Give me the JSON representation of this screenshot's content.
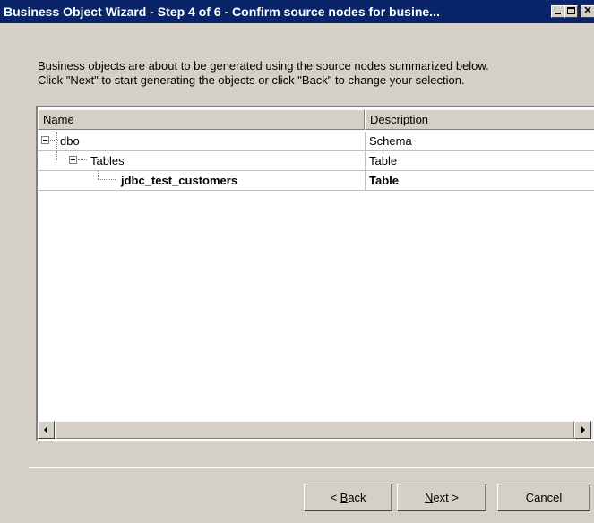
{
  "window": {
    "title": "Business Object Wizard - Step 4 of 6 - Confirm source nodes for busine..."
  },
  "instructions": {
    "line1": "Business objects are about to be generated using the source nodes summarized below.",
    "line2": "Click \"Next\" to start generating the objects or click \"Back\" to change your selection."
  },
  "list": {
    "columns": [
      "Name",
      "Description"
    ],
    "rows": [
      {
        "name": "dbo",
        "description": "Schema",
        "level": 0
      },
      {
        "name": "Tables",
        "description": "Table",
        "level": 1
      },
      {
        "name": "jdbc_test_customers",
        "description": "Table",
        "level": 2
      }
    ]
  },
  "buttons": {
    "back": {
      "prefix": "< ",
      "accel": "B",
      "rest": "ack"
    },
    "next": {
      "accel": "N",
      "rest": "ext >"
    },
    "cancel": "Cancel"
  }
}
